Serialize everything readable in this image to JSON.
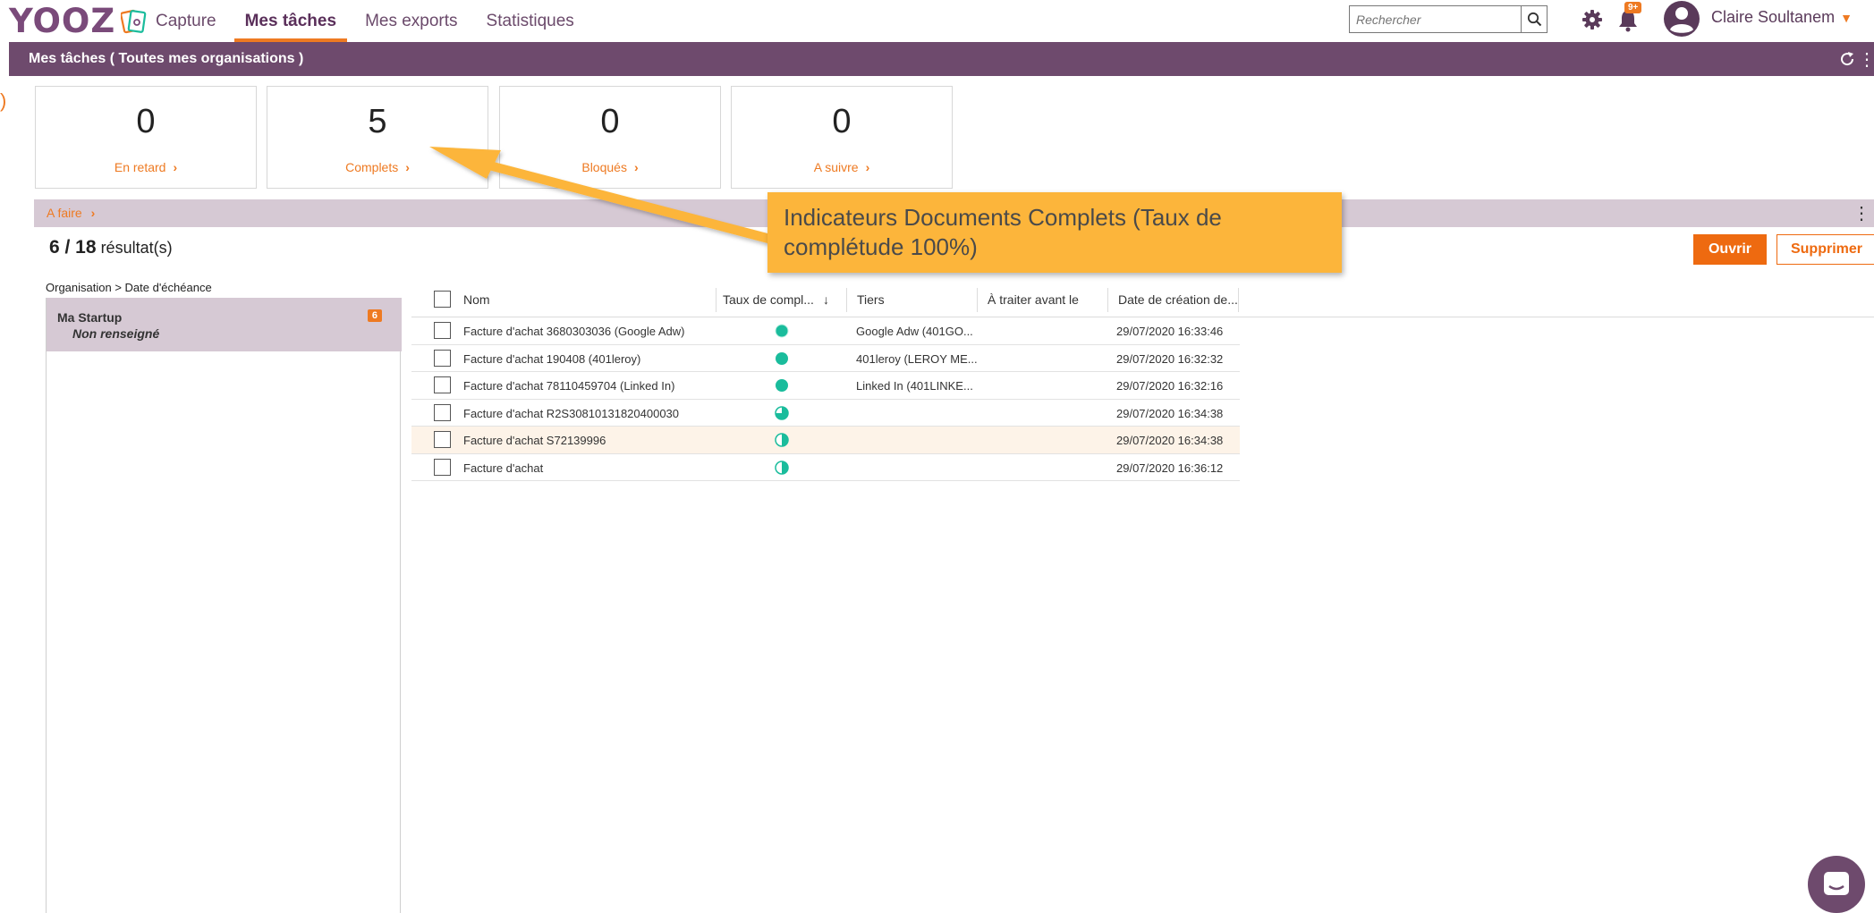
{
  "header": {
    "logo": "YOOZ",
    "tabs": [
      {
        "label": "Capture",
        "active": false
      },
      {
        "label": "Mes tâches",
        "active": true
      },
      {
        "label": "Mes exports",
        "active": false
      },
      {
        "label": "Statistiques",
        "active": false
      }
    ],
    "search_placeholder": "Rechercher",
    "notification_badge": "9+",
    "user_name": "Claire Soultanem"
  },
  "page_bar": {
    "title": "Mes tâches ( Toutes mes organisations )"
  },
  "kpis": [
    {
      "value": "0",
      "label": "En retard"
    },
    {
      "value": "5",
      "label": "Complets"
    },
    {
      "value": "0",
      "label": "Bloqués"
    },
    {
      "value": "0",
      "label": "A suivre"
    }
  ],
  "section": {
    "label": "A faire"
  },
  "results": {
    "count": "6 / 18",
    "suffix": "résultat(s)"
  },
  "actions": {
    "open_label": "Ouvrir",
    "delete_label": "Supprimer"
  },
  "tree": {
    "header": "Organisation > Date d'échéance",
    "items": [
      {
        "name": "Ma Startup",
        "sub": "Non renseigné",
        "count": "6"
      }
    ]
  },
  "table": {
    "columns": [
      "Nom",
      "Taux de compl...",
      "Tiers",
      "À traiter avant le",
      "Date de création de..."
    ],
    "rows": [
      {
        "name": "Facture d'achat 3680303036 (Google Adw)",
        "status": "full",
        "tiers": "Google Adw (401GO...",
        "due": "",
        "created": "29/07/2020 16:33:46"
      },
      {
        "name": "Facture d'achat 190408 (401leroy)",
        "status": "full",
        "tiers": "401leroy (LEROY ME...",
        "due": "",
        "created": "29/07/2020 16:32:32"
      },
      {
        "name": "Facture d'achat 78110459704 (Linked In)",
        "status": "full",
        "tiers": "Linked In (401LINKE...",
        "due": "",
        "created": "29/07/2020 16:32:16"
      },
      {
        "name": "Facture d'achat R2S30810131820400030",
        "status": "three-quarter",
        "tiers": "",
        "due": "",
        "created": "29/07/2020 16:34:38"
      },
      {
        "name": "Facture d'achat S72139996",
        "status": "half",
        "tiers": "",
        "due": "",
        "created": "29/07/2020 16:34:38"
      },
      {
        "name": "Facture d'achat",
        "status": "half",
        "tiers": "",
        "due": "",
        "created": "29/07/2020 16:36:12"
      }
    ]
  },
  "callout": {
    "text": "Indicateurs Documents Complets (Taux de complétude 100%)"
  },
  "colors": {
    "brand_purple": "#6e4a6d",
    "accent_orange": "#ee7a22",
    "status_teal": "#1abc9c",
    "callout_yellow": "#fcb53b"
  }
}
